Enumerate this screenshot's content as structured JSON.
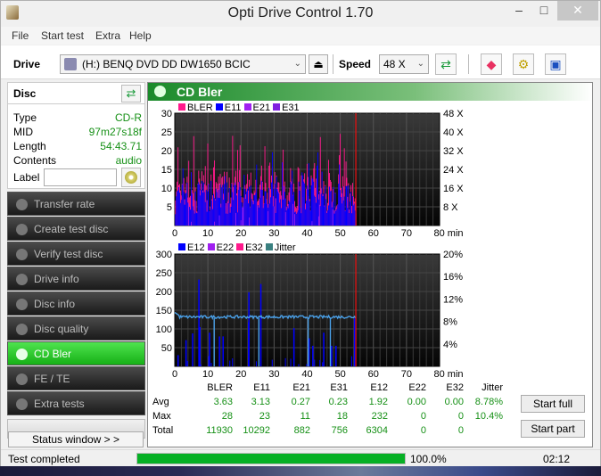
{
  "window": {
    "title": "Opti Drive Control 1.70",
    "minimize": "–",
    "maximize": "□",
    "close": "✕"
  },
  "menu": [
    "File",
    "Start test",
    "Extra",
    "Help"
  ],
  "toolbar": {
    "drive_label": "Drive",
    "drive_value": "(H:)  BENQ DVD DD DW1650 BCIC",
    "eject_icon": "⏏",
    "speed_label": "Speed",
    "speed_value": "48 X",
    "refresh_icon": "⇄",
    "erase_icon": "◆",
    "settings_icon": "⚙",
    "save_icon": "▣"
  },
  "disc": {
    "title": "Disc",
    "refresh_icon": "⇄",
    "rows": [
      {
        "key": "Type",
        "value": "CD-R"
      },
      {
        "key": "MID",
        "value": "97m27s18f"
      },
      {
        "key": "Length",
        "value": "54:43.71"
      },
      {
        "key": "Contents",
        "value": "audio"
      }
    ],
    "label_key": "Label",
    "label_value": ""
  },
  "nav": [
    {
      "label": "Transfer rate",
      "active": false
    },
    {
      "label": "Create test disc",
      "active": false
    },
    {
      "label": "Verify test disc",
      "active": false
    },
    {
      "label": "Drive info",
      "active": false
    },
    {
      "label": "Disc info",
      "active": false
    },
    {
      "label": "Disc quality",
      "active": false
    },
    {
      "label": "CD Bler",
      "active": true
    },
    {
      "label": "FE / TE",
      "active": false
    },
    {
      "label": "Extra tests",
      "active": false
    }
  ],
  "status_window_button": "Status window > >",
  "main": {
    "title": "CD Bler"
  },
  "chart_data": [
    {
      "type": "bar",
      "title": "",
      "legend": [
        {
          "name": "BLER",
          "color": "#ff1a8c"
        },
        {
          "name": "E11",
          "color": "#0000ff"
        },
        {
          "name": "E21",
          "color": "#a020f0"
        },
        {
          "name": "E31",
          "color": "#8020e0"
        }
      ],
      "legend_position": "top-left",
      "xlabel": "min",
      "xlim": [
        0,
        80
      ],
      "x_ticks": [
        "0",
        "10",
        "20",
        "30",
        "40",
        "50",
        "60",
        "70",
        "80 min"
      ],
      "ylim": [
        0,
        30
      ],
      "y_ticks": [
        "5",
        "10",
        "15",
        "20",
        "25",
        "30"
      ],
      "y2_ticks": [
        "8 X",
        "16 X",
        "24 X",
        "32 X",
        "40 X",
        "48 X"
      ],
      "y2lim": [
        0,
        48
      ],
      "end_marker_min": 54.7,
      "grid": true,
      "series_summary": {
        "BLER": {
          "typical_range": [
            5,
            15
          ],
          "peak": 28
        },
        "E11": {
          "typical_range": [
            3,
            12
          ],
          "peak": 23
        }
      }
    },
    {
      "type": "bar",
      "title": "",
      "legend": [
        {
          "name": "E12",
          "color": "#0000ff"
        },
        {
          "name": "E22",
          "color": "#a020f0"
        },
        {
          "name": "E32",
          "color": "#ff1a8c"
        },
        {
          "name": "Jitter",
          "color": "#3a8080"
        }
      ],
      "legend_position": "top-left",
      "xlabel": "min",
      "xlim": [
        0,
        80
      ],
      "x_ticks": [
        "0",
        "10",
        "20",
        "30",
        "40",
        "50",
        "60",
        "70",
        "80 min"
      ],
      "ylim": [
        0,
        300
      ],
      "y_ticks": [
        "50",
        "100",
        "150",
        "200",
        "250",
        "300"
      ],
      "y2lim": [
        0,
        20
      ],
      "y2_ticks": [
        "4%",
        "8%",
        "12%",
        "16%",
        "20%"
      ],
      "end_marker_min": 54.7,
      "grid": true,
      "e12_spikes": [
        [
          0.8,
          30
        ],
        [
          3.2,
          70
        ],
        [
          5.2,
          88
        ],
        [
          7.1,
          232
        ],
        [
          7.4,
          105
        ],
        [
          10.3,
          90
        ],
        [
          13.3,
          80
        ],
        [
          14.4,
          80
        ],
        [
          22.2,
          198
        ],
        [
          22.1,
          118
        ],
        [
          25.8,
          220
        ],
        [
          35.8,
          102
        ],
        [
          40.4,
          75
        ],
        [
          41.5,
          55
        ],
        [
          44.8,
          90
        ],
        [
          47.2,
          55
        ],
        [
          48.5,
          55
        ],
        [
          54.1,
          128
        ]
      ],
      "jitter_percent": {
        "start": 9.6,
        "typical": 8.8,
        "end": 9.0,
        "max": 10.4
      }
    }
  ],
  "stats": {
    "columns": [
      "BLER",
      "E11",
      "E21",
      "E31",
      "E12",
      "E22",
      "E32",
      "Jitter"
    ],
    "rows": [
      {
        "label": "Avg",
        "values": [
          "3.63",
          "3.13",
          "0.27",
          "0.23",
          "1.92",
          "0.00",
          "0.00",
          "8.78%"
        ]
      },
      {
        "label": "Max",
        "values": [
          "28",
          "23",
          "11",
          "18",
          "232",
          "0",
          "0",
          "10.4%"
        ]
      },
      {
        "label": "Total",
        "values": [
          "11930",
          "10292",
          "882",
          "756",
          "6304",
          "0",
          "0",
          ""
        ]
      }
    ]
  },
  "buttons": {
    "start_full": "Start full",
    "start_part": "Start part"
  },
  "statusbar": {
    "text": "Test completed",
    "progress": 100.0,
    "progress_label": "100.0%",
    "time": "02:12"
  }
}
